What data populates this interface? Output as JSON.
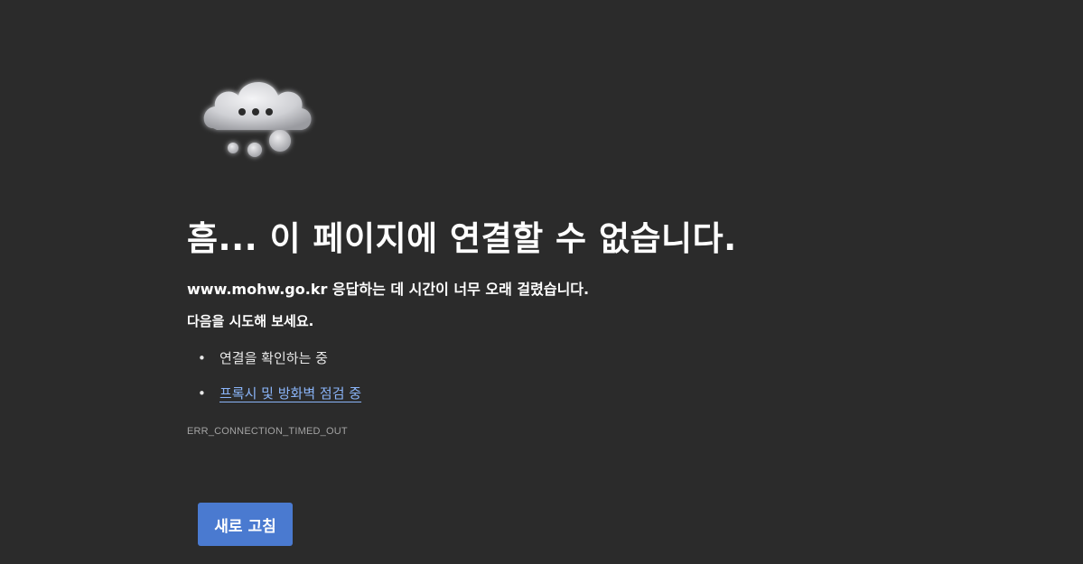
{
  "error_page": {
    "title": "흠... 이 페이지에 연결할 수 없습니다.",
    "domain": "www.mohw.go.kr",
    "summary_tail": " 응답하는 데 시간이 너무 오래 걸렸습니다.",
    "suggestions_heading": "다음을 시도해 보세요.",
    "suggestions": [
      {
        "label": "연결을 확인하는 중",
        "is_link": false
      },
      {
        "label": "프록시 및 방화벽 점검 중",
        "is_link": true
      }
    ],
    "error_code": "ERR_CONNECTION_TIMED_OUT",
    "reload_label": "새로 고침",
    "icon": "cloud-error-icon"
  },
  "colors": {
    "background": "#2b2b2b",
    "text": "#ffffff",
    "link": "#8ab4f8",
    "error_code": "#a3a3a3",
    "button": "#4a7ad0"
  }
}
